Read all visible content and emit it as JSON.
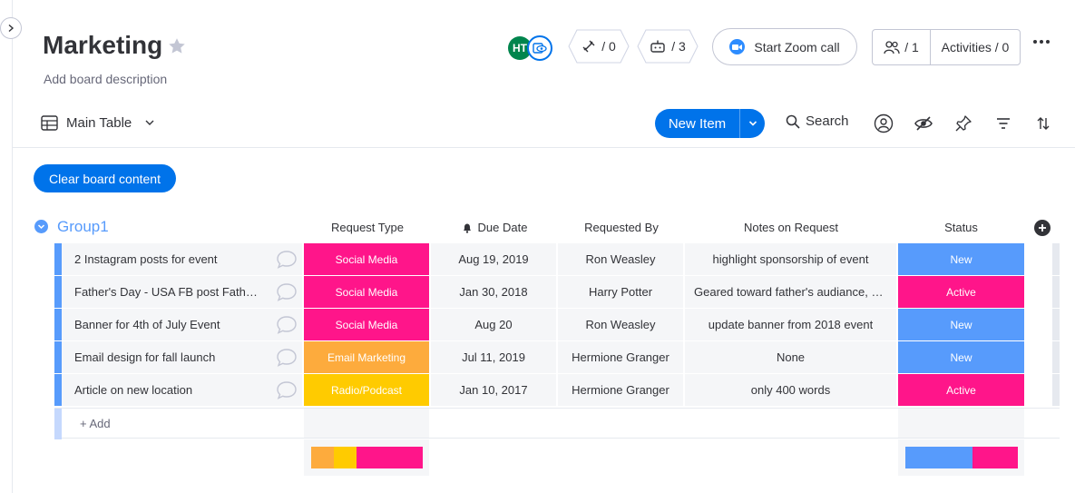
{
  "board": {
    "title": "Marketing",
    "description": "Add board description"
  },
  "header": {
    "avatar_initials": "HT",
    "integrations_count": "/ 0",
    "automations_count": "/ 3",
    "zoom_label": "Start Zoom call",
    "members_count": "/ 1",
    "activities_label": "Activities / 0"
  },
  "toolbar": {
    "view_label": "Main Table",
    "new_item_label": "New Item",
    "search_label": "Search",
    "clear_label": "Clear board content"
  },
  "group": {
    "title": "Group1",
    "color": "#579bfc",
    "add_label": "+ Add"
  },
  "columns": {
    "request_type": "Request Type",
    "due_date": "Due Date",
    "requested_by": "Requested By",
    "notes": "Notes on Request",
    "status": "Status"
  },
  "rows": [
    {
      "item": "2 Instagram posts for event",
      "type": "Social Media",
      "type_color": "#ff158a",
      "due": "Aug 19, 2019",
      "by": "Ron Weasley",
      "notes": "highlight sponsorship of event",
      "status": "New",
      "status_color": "#579bfc"
    },
    {
      "item": "Father's Day - USA FB post Father's Day",
      "type": "Social Media",
      "type_color": "#ff158a",
      "due": "Jan 30, 2018",
      "by": "Harry Potter",
      "notes": "Geared toward father's audiance, use",
      "status": "Active",
      "status_color": "#ff158a"
    },
    {
      "item": "Banner for 4th of July Event",
      "type": "Social Media",
      "type_color": "#ff158a",
      "due": "Aug 20",
      "by": "Ron Weasley",
      "notes": "update banner from 2018 event",
      "status": "New",
      "status_color": "#579bfc"
    },
    {
      "item": "Email design for fall launch",
      "type": "Email Marketing",
      "type_color": "#fdab3d",
      "due": "Jul 11, 2019",
      "by": "Hermione Granger",
      "notes": "None",
      "status": "New",
      "status_color": "#579bfc"
    },
    {
      "item": "Article on new location",
      "type": "Radio/Podcast",
      "type_color": "#ffcb00",
      "due": "Jan 10, 2017",
      "by": "Hermione Granger",
      "notes": "only 400 words",
      "status": "Active",
      "status_color": "#ff158a"
    }
  ],
  "summary": {
    "request_type": [
      {
        "color": "#fdab3d",
        "fraction": 0.2
      },
      {
        "color": "#ffcb00",
        "fraction": 0.2
      },
      {
        "color": "#ff158a",
        "fraction": 0.6
      }
    ],
    "status": [
      {
        "color": "#579bfc",
        "fraction": 0.6
      },
      {
        "color": "#ff158a",
        "fraction": 0.4
      }
    ]
  }
}
